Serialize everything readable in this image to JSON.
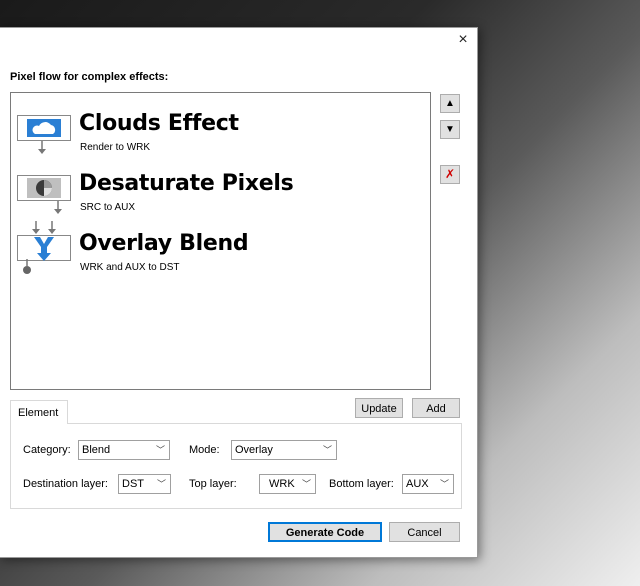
{
  "dialog": {
    "heading": "Pixel flow for complex effects:",
    "close_glyph": "×"
  },
  "flow_items": [
    {
      "title": "Clouds Effect",
      "subtitle": "Render to WRK",
      "icon": "clouds-icon"
    },
    {
      "title": "Desaturate Pixels",
      "subtitle": "SRC to AUX",
      "icon": "desaturate-icon"
    },
    {
      "title": "Overlay Blend",
      "subtitle": "WRK and AUX to DST",
      "icon": "blend-icon"
    }
  ],
  "side_buttons": {
    "up": "▲",
    "down": "▼",
    "delete": "✗"
  },
  "actions": {
    "update": "Update",
    "add": "Add"
  },
  "tabs": {
    "element": "Element"
  },
  "fields": {
    "category_label": "Category:",
    "category_value": "Blend",
    "mode_label": "Mode:",
    "mode_value": "Overlay",
    "dest_label": "Destination layer:",
    "dest_value": "DST",
    "top_label": "Top layer:",
    "top_value": "WRK",
    "bottom_label": "Bottom layer:",
    "bottom_value": "AUX"
  },
  "footer": {
    "generate": "Generate Code",
    "cancel": "Cancel"
  },
  "colors": {
    "accent": "#0078d7",
    "icon_blue": "#2a7fd4",
    "delete_red": "#d00000"
  }
}
